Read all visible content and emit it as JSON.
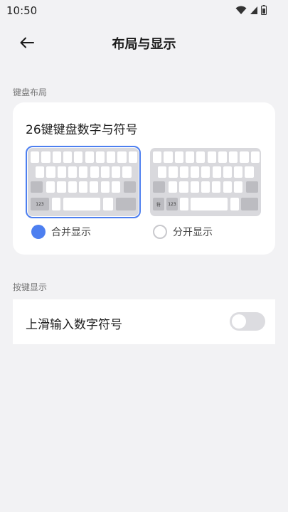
{
  "status_bar": {
    "time": "10:50"
  },
  "header": {
    "title": "布局与显示"
  },
  "keyboard_layout_section": {
    "label": "键盘布局",
    "title": "26键键盘数字与符号",
    "options": [
      {
        "label": "合并显示",
        "selected": true,
        "keys": [
          "123"
        ]
      },
      {
        "label": "分开显示",
        "selected": false,
        "keys": [
          "符",
          "123"
        ]
      }
    ]
  },
  "key_display_section": {
    "label": "按键显示",
    "swipe_up_label": "上滑输入数字符号",
    "swipe_up_enabled": false
  },
  "colors": {
    "accent": "#4d7ff0",
    "background": "#f2f2f4",
    "card": "#ffffff"
  }
}
